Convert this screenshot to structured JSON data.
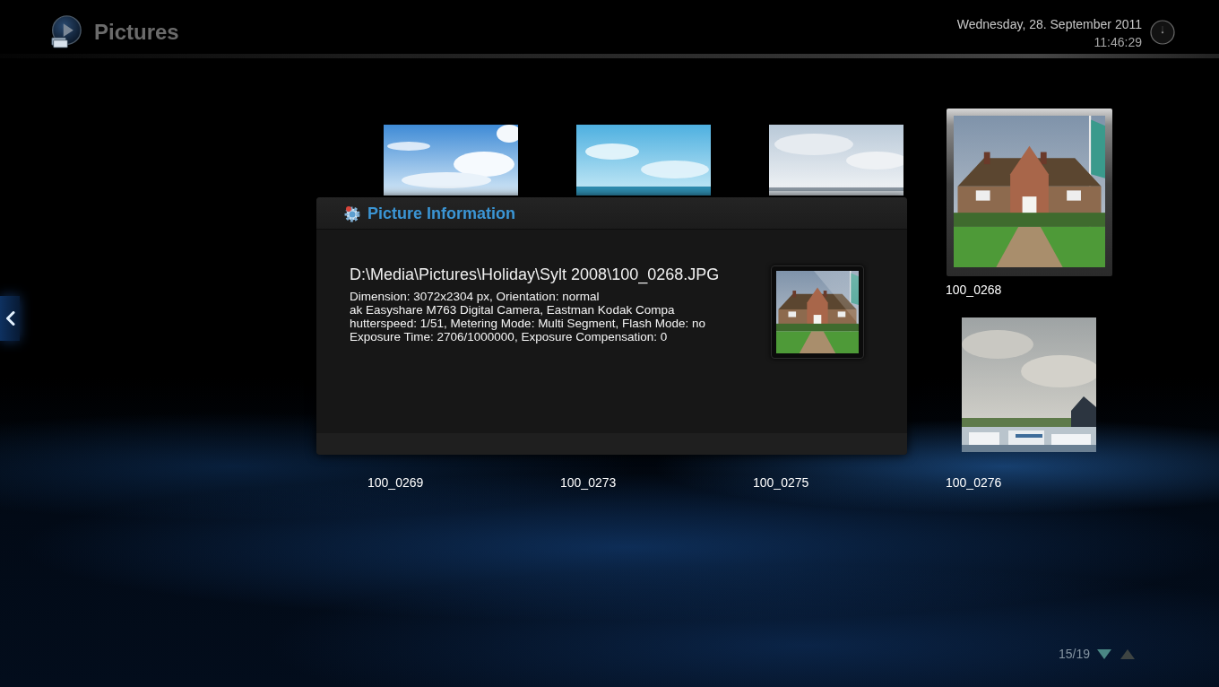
{
  "header": {
    "title": "Pictures",
    "date": "Wednesday, 28. September 2011",
    "time": "11:46:29"
  },
  "grid": {
    "rows": [
      {
        "items": [
          {
            "kind": "sky",
            "selected": false
          },
          {
            "kind": "sea",
            "selected": false
          },
          {
            "kind": "clouds",
            "selected": false
          },
          {
            "kind": "house",
            "label": "100_0268",
            "selected": true
          }
        ]
      },
      {
        "items": [
          {
            "label": "100_0269",
            "selected": false
          },
          {
            "label": "100_0273",
            "selected": false
          },
          {
            "label": "100_0275",
            "selected": false
          },
          {
            "kind": "town",
            "label": "100_0276",
            "selected": false
          }
        ]
      }
    ]
  },
  "dialog": {
    "title": "Picture Information",
    "path": "D:\\Media\\Pictures\\Holiday\\Sylt 2008\\100_0268.JPG",
    "details": [
      "Dimension: 3072x2304 px, Orientation: normal",
      "ak Easyshare M763 Digital Camera, Eastman Kodak Compa",
      "hutterspeed: 1/51, Metering Mode: Multi Segment, Flash Mode: no",
      "Exposure Time: 2706/1000000, Exposure Compensation: 0"
    ],
    "preview": {
      "kind": "house"
    }
  },
  "pager": {
    "text": "15/19",
    "arrows": [
      {
        "kind": "down",
        "highlighted": true
      },
      {
        "kind": "up",
        "highlighted": false
      }
    ]
  }
}
